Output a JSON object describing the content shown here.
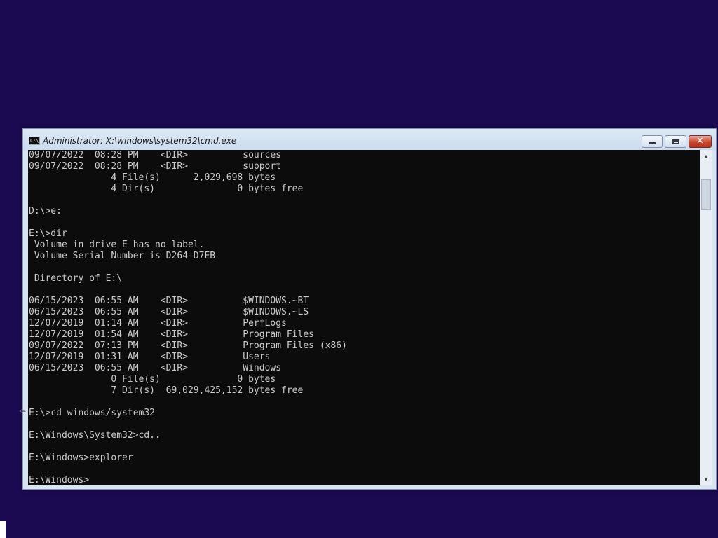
{
  "window": {
    "title": "Administrator: X:\\windows\\system32\\cmd.exe",
    "icon_label": "C:\\",
    "close_glyph": "✕"
  },
  "console": {
    "lines": [
      "09/07/2022  08:28 PM    <DIR>          sources",
      "09/07/2022  08:28 PM    <DIR>          support",
      "               4 File(s)      2,029,698 bytes",
      "               4 Dir(s)               0 bytes free",
      "",
      "D:\\>e:",
      "",
      "E:\\>dir",
      " Volume in drive E has no label.",
      " Volume Serial Number is D264-D7EB",
      "",
      " Directory of E:\\",
      "",
      "06/15/2023  06:55 AM    <DIR>          $WINDOWS.~BT",
      "06/15/2023  06:55 AM    <DIR>          $WINDOWS.~LS",
      "12/07/2019  01:14 AM    <DIR>          PerfLogs",
      "12/07/2019  01:54 AM    <DIR>          Program Files",
      "09/07/2022  07:13 PM    <DIR>          Program Files (x86)",
      "12/07/2019  01:31 AM    <DIR>          Users",
      "06/15/2023  06:55 AM    <DIR>          Windows",
      "               0 File(s)              0 bytes",
      "               7 Dir(s)  69,029,425,152 bytes free",
      "",
      "E:\\>cd windows/system32",
      "",
      "E:\\Windows\\System32>cd..",
      "",
      "E:\\Windows>explorer",
      "",
      "E:\\Windows>"
    ]
  },
  "scrollbar": {
    "up_glyph": "▲",
    "down_glyph": "▼"
  },
  "cursor": {
    "glyph": "⇔"
  },
  "colors": {
    "desktop": "#1b0a52",
    "console_bg": "#0c0c0c",
    "console_fg": "#cccccc"
  }
}
